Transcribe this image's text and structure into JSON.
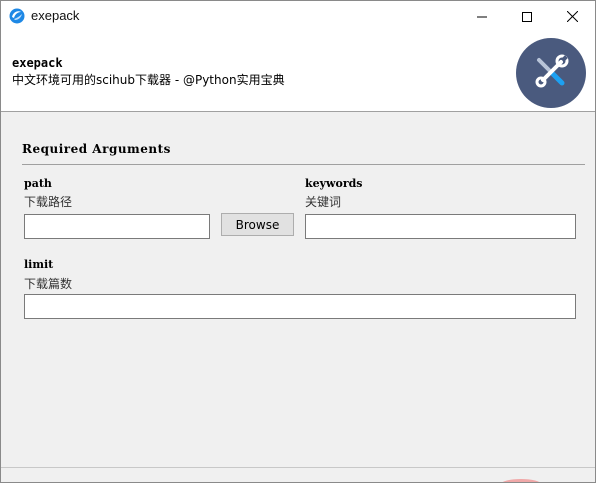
{
  "window": {
    "title": "exepack",
    "controls": {
      "minimize": "minimize-icon",
      "maximize": "maximize-icon",
      "close": "close-icon"
    }
  },
  "header": {
    "title": "exepack",
    "subtitle": "中文环境可用的scihub下载器 - @Python实用宝典",
    "image_icon": "tools-icon"
  },
  "section": {
    "title": "Required Arguments"
  },
  "fields": {
    "path": {
      "label": "path",
      "help": "下载路径",
      "value": "",
      "button_label": "Browse"
    },
    "keywords": {
      "label": "keywords",
      "help": "关键词",
      "value": ""
    },
    "limit": {
      "label": "limit",
      "help": "下载篇数",
      "value": ""
    }
  },
  "colors": {
    "header_bg": "#ffffff",
    "body_bg": "#f0f0f0",
    "badge_bg": "#4a5a7e",
    "app_icon_blue": "#1e88e5"
  }
}
